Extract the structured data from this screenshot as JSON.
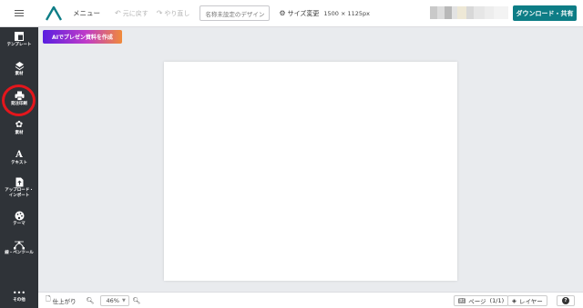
{
  "header": {
    "menu_label": "メニュー",
    "undo_label": "元に戻す",
    "redo_label": "やり直し",
    "design_name_placeholder": "名称未設定のデザイン",
    "size_change_label": "サイズ変更",
    "size_value": "1500 × 1125px",
    "download_share_label": "ダウンロード・共有"
  },
  "sidebar": {
    "items": [
      {
        "label": "テンプレート",
        "icon": "template-icon"
      },
      {
        "label": "素材",
        "icon": "layers-icon"
      },
      {
        "label": "発注印刷",
        "icon": "printer-icon"
      },
      {
        "label": "素材",
        "icon": "shapes-icon"
      },
      {
        "label": "テキスト",
        "icon": "text-icon"
      },
      {
        "label": "アップロード・",
        "label2": "インポート",
        "icon": "upload-icon"
      },
      {
        "label": "テーマ",
        "icon": "palette-icon"
      },
      {
        "label": "線・ペンツール",
        "icon": "pen-tool-icon"
      },
      {
        "label": "その他",
        "icon": "more-icon"
      }
    ]
  },
  "ai_button_label": "AIでプレゼン資料を作成",
  "footer": {
    "finish_label": "仕上がり",
    "zoom_value": "46%",
    "page_label": "ページ",
    "page_count": "(1/1)",
    "layer_label": "レイヤー",
    "help_label": "?"
  },
  "colors": {
    "accent": "#0d7d86",
    "sidebar_bg": "#2f3338",
    "highlight": "#e4161c"
  }
}
